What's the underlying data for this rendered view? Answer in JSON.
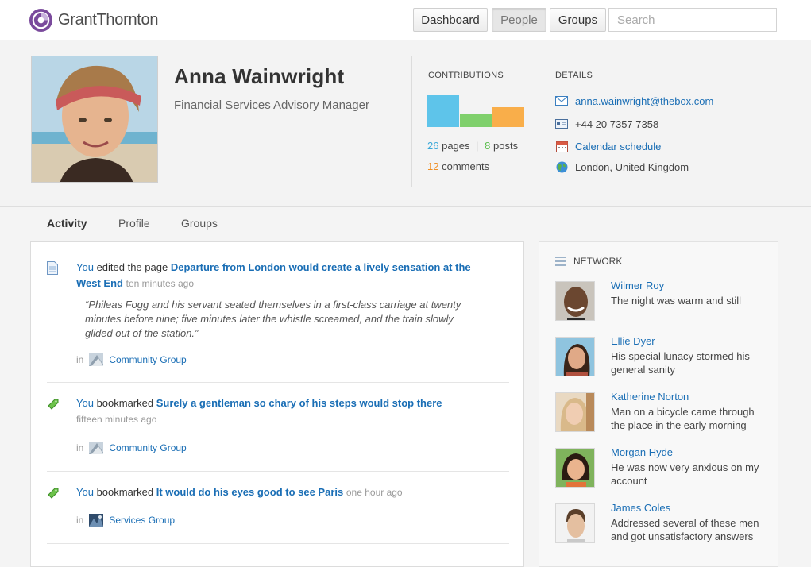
{
  "header": {
    "logo_text": "GrantThornton",
    "nav": [
      "Dashboard",
      "People",
      "Groups"
    ],
    "active_nav": "People",
    "search_placeholder": "Search"
  },
  "profile": {
    "name": "Anna Wainwright",
    "title": "Financial Services Advisory Manager",
    "contributions": {
      "heading": "CONTRIBUTIONS",
      "pages_count": "26",
      "pages_label": "pages",
      "posts_count": "8",
      "posts_label": "posts",
      "comments_count": "12",
      "comments_label": "comments",
      "colors": {
        "pages": "#5ec4ea",
        "posts": "#7fd06c",
        "comments": "#f9ae4a"
      }
    },
    "details": {
      "heading": "DETAILS",
      "email": "anna.wainwright@thebox.com",
      "phone": "+44 20 7357 7358",
      "calendar": "Calendar schedule",
      "location": "London, United Kingdom"
    }
  },
  "tabs": [
    "Activity",
    "Profile",
    "Groups"
  ],
  "active_tab": "Activity",
  "activity": {
    "items": [
      {
        "icon": "page-icon",
        "actor": "You",
        "action": "edited the page",
        "target": "Departure from London would create a lively sensation at the West End",
        "time": "ten minutes ago",
        "quote": "“Phileas Fogg and his servant seated themselves in a first-class carriage at twenty minutes before nine; five minutes later the whistle screamed, and the train slowly glided out of the station.”",
        "in_label": "in",
        "group": "Community Group"
      },
      {
        "icon": "bookmark-icon",
        "actor": "You",
        "action": "bookmarked",
        "target": "Surely a gentleman so chary of his steps would stop there",
        "time": "fifteen minutes ago",
        "in_label": "in",
        "group": "Community Group"
      },
      {
        "icon": "bookmark-icon",
        "actor": "You",
        "action": "bookmarked",
        "target": "It would do his eyes good to see Paris",
        "time": "one hour ago",
        "in_label": "in",
        "group": "Services Group"
      }
    ]
  },
  "network": {
    "heading": "NETWORK",
    "people": [
      {
        "name": "Wilmer Roy",
        "text": "The night was warm and still"
      },
      {
        "name": "Ellie Dyer",
        "text": "His special lunacy stormed his general sanity"
      },
      {
        "name": "Katherine Norton",
        "text": "Man on a bicycle came through the place in the early morning"
      },
      {
        "name": "Morgan Hyde",
        "text": "He was now very anxious on my account"
      },
      {
        "name": "James Coles",
        "text": "Addressed several of these men and got unsatisfactory answers"
      }
    ]
  }
}
